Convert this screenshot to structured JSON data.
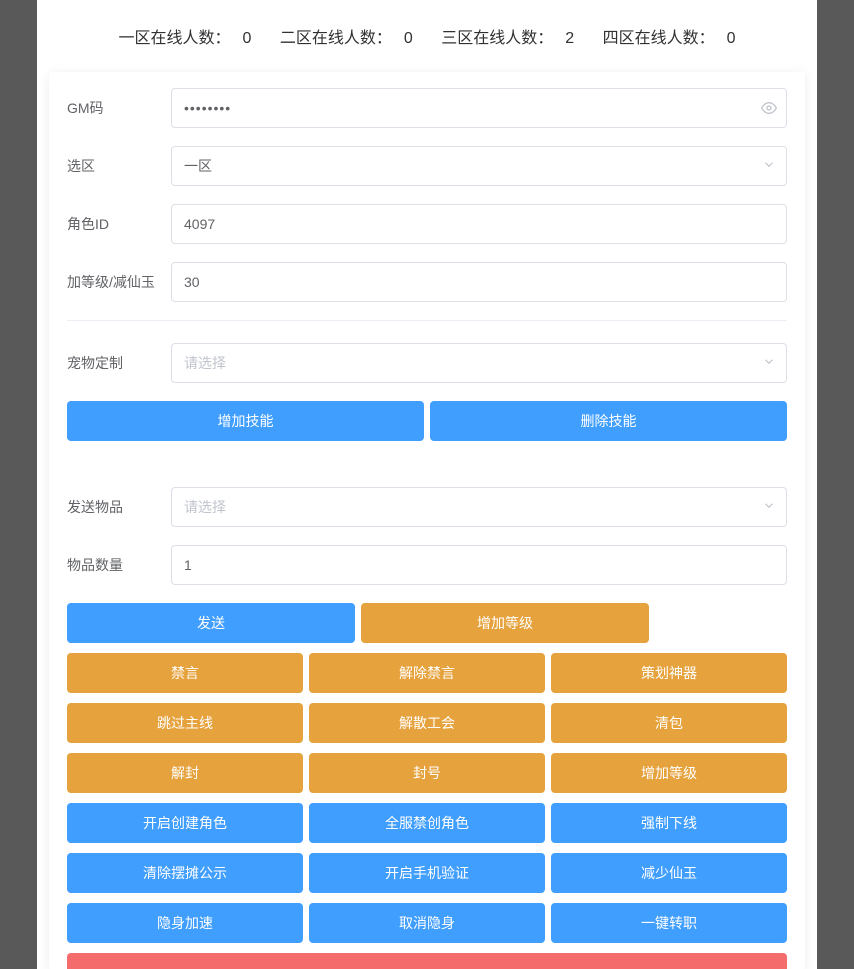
{
  "stats": {
    "zone1_label": "一区在线人数：",
    "zone1_value": "0",
    "zone2_label": "二区在线人数：",
    "zone2_value": "0",
    "zone3_label": "三区在线人数：",
    "zone3_value": "2",
    "zone4_label": "四区在线人数：",
    "zone4_value": "0"
  },
  "form": {
    "gm_code_label": "GM码",
    "gm_code_value": "••••••••",
    "zone_label": "选区",
    "zone_value": "一区",
    "role_id_label": "角色ID",
    "role_id_value": "4097",
    "level_label": "加等级/减仙玉",
    "level_value": "30",
    "pet_label": "宠物定制",
    "pet_placeholder": "请选择",
    "item_send_label": "发送物品",
    "item_send_placeholder": "请选择",
    "item_qty_label": "物品数量",
    "item_qty_value": "1"
  },
  "buttons": {
    "add_skill": "增加技能",
    "del_skill": "删除技能",
    "send": "发送",
    "add_level_a": "增加等级",
    "mute": "禁言",
    "unmute": "解除禁言",
    "plan_weapon": "策划神器",
    "skip_main": "跳过主线",
    "dismiss_guild": "解散工会",
    "clear_bag": "清包",
    "unban": "解封",
    "ban": "封号",
    "add_level_b": "增加等级",
    "enable_create": "开启创建角色",
    "disable_create": "全服禁创角色",
    "force_offline": "强制下线",
    "clear_stall": "清除摆摊公示",
    "enable_phone": "开启手机验证",
    "reduce_xianyu": "减少仙玉",
    "stealth_speed": "隐身加速",
    "cancel_stealth": "取消隐身",
    "onekey_transfer": "一键转职"
  }
}
